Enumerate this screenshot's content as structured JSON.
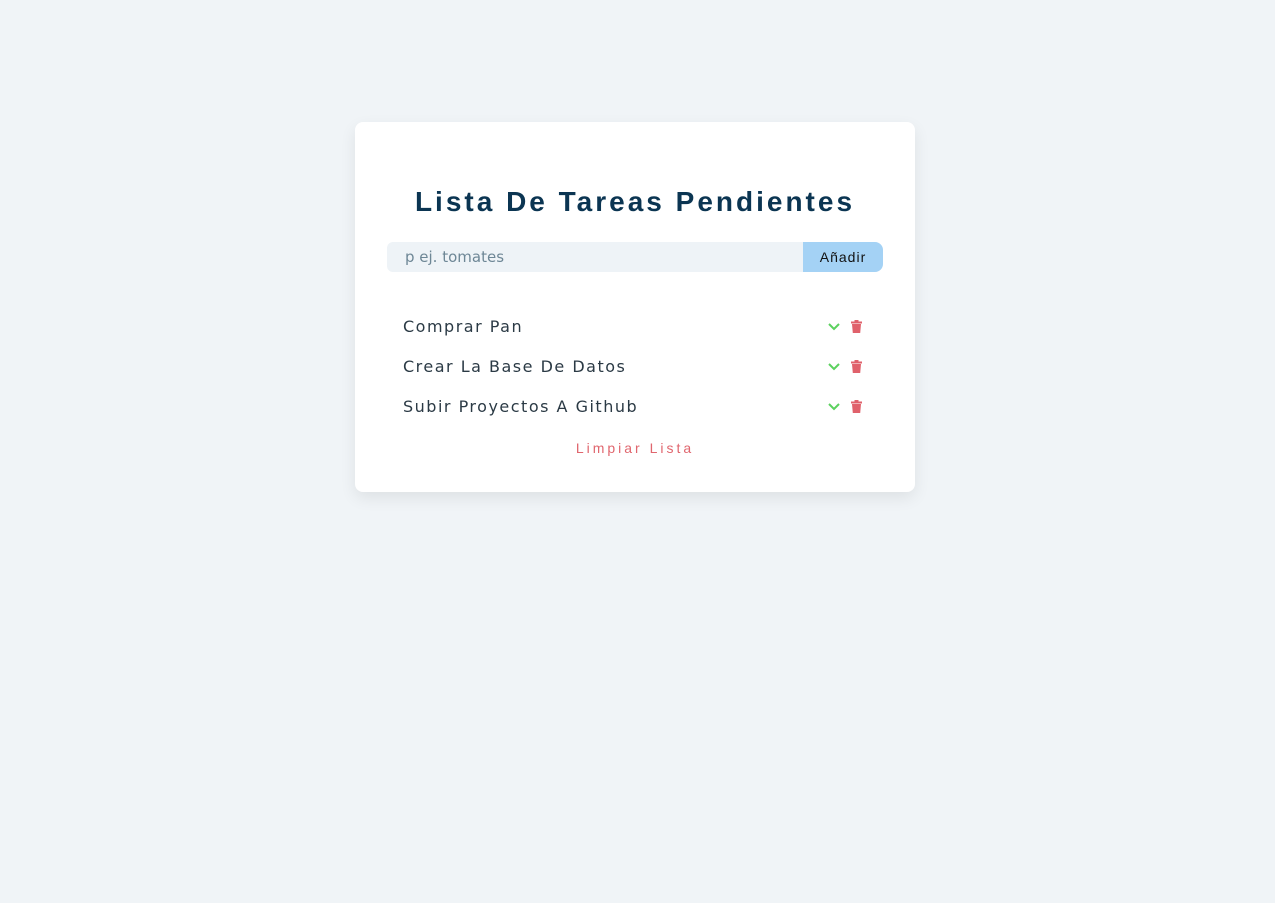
{
  "app": {
    "title": "Lista De Tareas Pendientes"
  },
  "form": {
    "input_value": "",
    "input_placeholder": "p ej. tomates",
    "add_label": "Añadir"
  },
  "tasks": [
    {
      "text": "Comprar Pan"
    },
    {
      "text": "Crear La Base De Datos"
    },
    {
      "text": "Subir Proyectos A Github"
    }
  ],
  "footer": {
    "clear_label": "Limpiar Lista"
  },
  "icons": {
    "complete": "check-icon",
    "delete": "trash-icon"
  },
  "colors": {
    "background": "#f0f4f7",
    "title": "#0b3552",
    "add_button": "#a4d2f5",
    "check": "#5bd15e",
    "trash": "#e0616b",
    "clear": "#e0666e"
  }
}
